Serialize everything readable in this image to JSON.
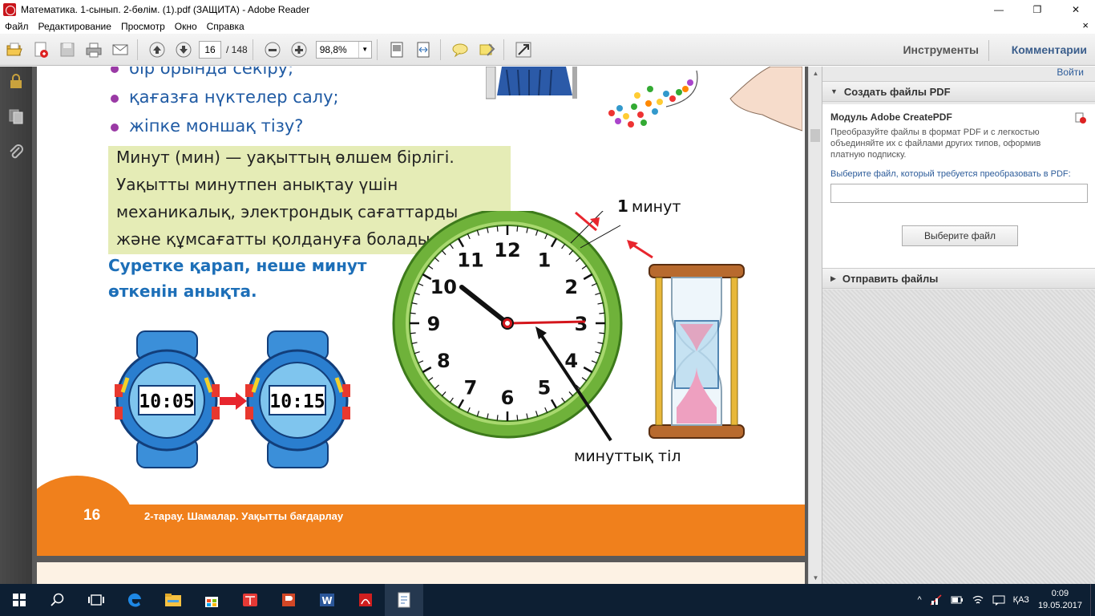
{
  "window": {
    "title": "Математика. 1-сынып. 2-бөлім. (1).pdf (ЗАЩИТА) - Adobe Reader",
    "minimize": "—",
    "maximize": "❐",
    "close": "✕"
  },
  "menu": {
    "items": [
      "Файл",
      "Редактирование",
      "Просмотр",
      "Окно",
      "Справка"
    ],
    "close_doc": "×"
  },
  "toolbar": {
    "page_current": "16",
    "page_total": "/ 148",
    "zoom": "98,8%",
    "tools_label": "Инструменты",
    "comments_label": "Комментарии"
  },
  "document": {
    "bullets": [
      "бір орында секіру;",
      "қағазға нүктелер салу;",
      "жіпке моншақ тізу?"
    ],
    "definition_lines": [
      "Минут (мин) — уақыттың өлшем бірлігі.",
      "Уақытты минутпен анықтау үшін",
      "механикалық, электрондық сағаттарды",
      "және құмсағатты қолдануға болады."
    ],
    "task_lines": [
      "Суретке қарап, неше минут",
      "өткенін анықта."
    ],
    "watch_before": "10:05",
    "watch_after": "10:15",
    "clock_numbers": [
      "12",
      "1",
      "2",
      "3",
      "4",
      "5",
      "6",
      "7",
      "8",
      "9",
      "10",
      "11"
    ],
    "label_minute_num": "1",
    "label_minute_word": "минут",
    "label_minute_hand": "минуттық тіл",
    "page_number": "16",
    "footer_title": "2-тарау. Шамалар. Уақытты бағдарлау"
  },
  "right_panel": {
    "hide_link": "Войти",
    "section_create": "Создать файлы PDF",
    "module_title": "Модуль Adobe CreatePDF",
    "module_desc": "Преобразуйте файлы в формат PDF и с легкостью объединяйте их с файлами других типов, оформив платную подписку.",
    "choose_prompt": "Выберите файл, который требуется преобразовать в PDF:",
    "choose_button": "Выберите файл",
    "section_send": "Отправить файлы"
  },
  "taskbar": {
    "language": "ҚАЗ",
    "time": "0:09",
    "date": "19.05.2017"
  },
  "colors": {
    "accent_blue": "#1d6fb8",
    "footer_orange": "#f0801c",
    "clock_green": "#7bbf3a",
    "taskbar": "#0d1f33"
  }
}
